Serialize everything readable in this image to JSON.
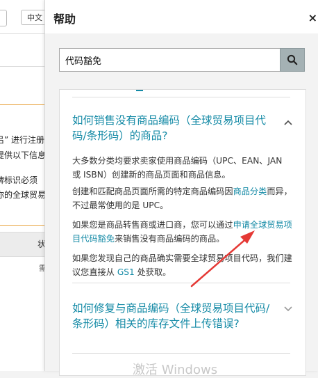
{
  "background_page": {
    "language": "中文",
    "notice_lines": [
      "吕” 进行注册",
      "提供以下信息",
      "牌标识必须",
      "你的全球贸易"
    ],
    "table_header": "状",
    "table_cell": "需"
  },
  "help": {
    "title": "帮助",
    "close_label": "×",
    "search": {
      "value": "代码豁免",
      "placeholder": ""
    },
    "faq1": {
      "question": "如何销售没有商品编码（全球贸易项目代码/条形码）的商品?",
      "p1": "大多数分类均要求卖家使用商品编码（UPC、EAN、JAN 或 ISBN）创建新的商品页面和商品信息。",
      "p2_a": "创建和匹配商品页面所需的特定商品编码因",
      "p2_link": "商品分类",
      "p2_b": "而异，不过最常使用的是 UPC。",
      "p3_a": "如果您是商品转售商或进口商，您可以通过",
      "p3_link": "申请全球贸易项目代码豁免",
      "p3_b": "来销售没有商品编码的商品。",
      "p4_a": "如果您发现自己的商品确实需要全球贸易项目代码，我们建议您直接从 ",
      "p4_link": "GS1",
      "p4_b": " 处获取。"
    },
    "faq2": {
      "question": "如何修复与商品编码（全球贸易项目代码/条形码）相关的库存文件上传错误?"
    },
    "watermark": "激活 Windows"
  },
  "colors": {
    "link": "#148aa6",
    "search_button": "#a4b1b4",
    "arrow": "#e53935",
    "notice_border": "#e8a33d"
  }
}
